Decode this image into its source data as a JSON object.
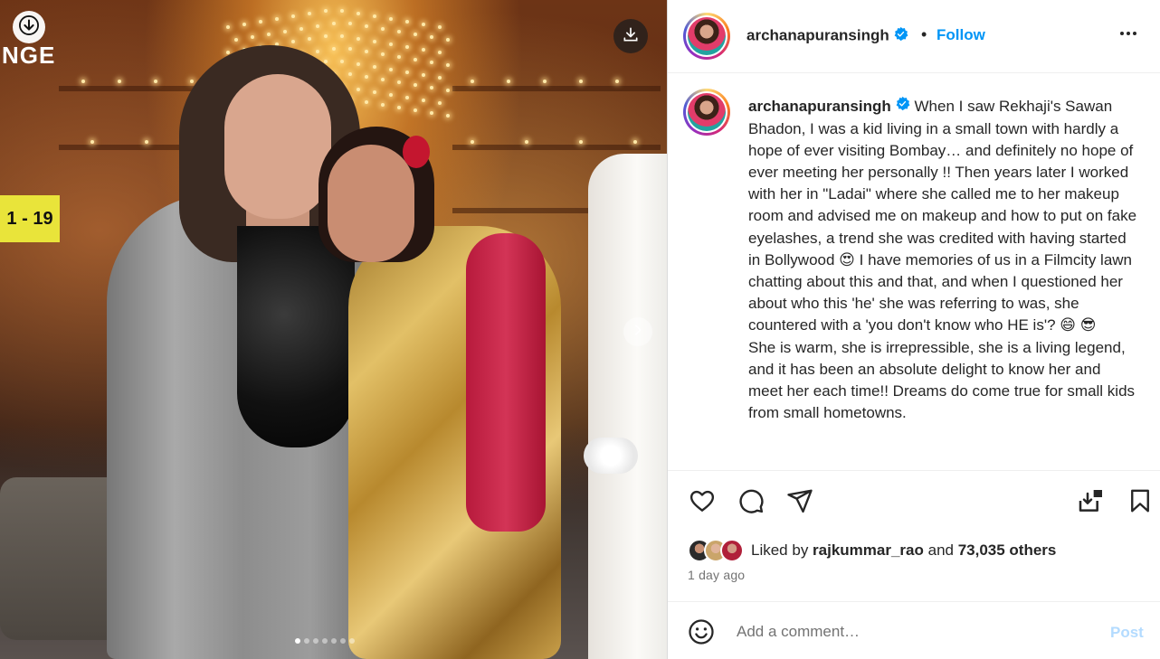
{
  "media": {
    "sign_top": "NGE",
    "sign_number": "1 - 19",
    "dots_total": 7,
    "dots_active_index": 0
  },
  "header": {
    "username": "archanapuransingh",
    "separator": "•",
    "follow_label": "Follow"
  },
  "caption": {
    "username": "archanapuransingh",
    "text_part1": " When I saw Rekhaji's Sawan Bhadon, I was a kid living in a small town with hardly a hope of ever visiting Bombay… and definitely no hope of ever meeting her personally !! Then years later I worked with her in \"Ladai\" where she called me to her makeup room and advised me on makeup and how to put on fake eyelashes, a trend she was credited with having started in Bollywood ",
    "emoji1": "😍",
    "text_part2": " I have memories of us in a Filmcity lawn chatting about this and that, and when I questioned her about who this 'he' she was referring to was, she countered with a 'you don't know who HE is'? ",
    "emoji2": "😄",
    "emoji3": "😎",
    "text_part3": "\nShe is warm, she is irrepressible, she is a living legend, and it has been an absolute delight to know her and meet her each time!! Dreams do come true for small kids from small hometowns."
  },
  "likes": {
    "prefix": "Liked by ",
    "liker": "rajkummar_rao",
    "middle": " and ",
    "count": "73,035 others"
  },
  "time_ago": "1 day ago",
  "comment": {
    "placeholder": "Add a comment…",
    "post_label": "Post"
  },
  "colors": {
    "link_blue": "#0095f6",
    "post_disabled": "#b3dbff",
    "verified_blue": "#0095f6",
    "text_primary": "#262626",
    "text_secondary": "#737373"
  },
  "icons": [
    "download-icon",
    "download-icon",
    "chevron-right-icon",
    "verified-badge-icon",
    "more-icon",
    "heart-icon",
    "comment-icon",
    "share-icon",
    "save-to-collection-icon",
    "bookmark-icon",
    "emoji-icon"
  ]
}
